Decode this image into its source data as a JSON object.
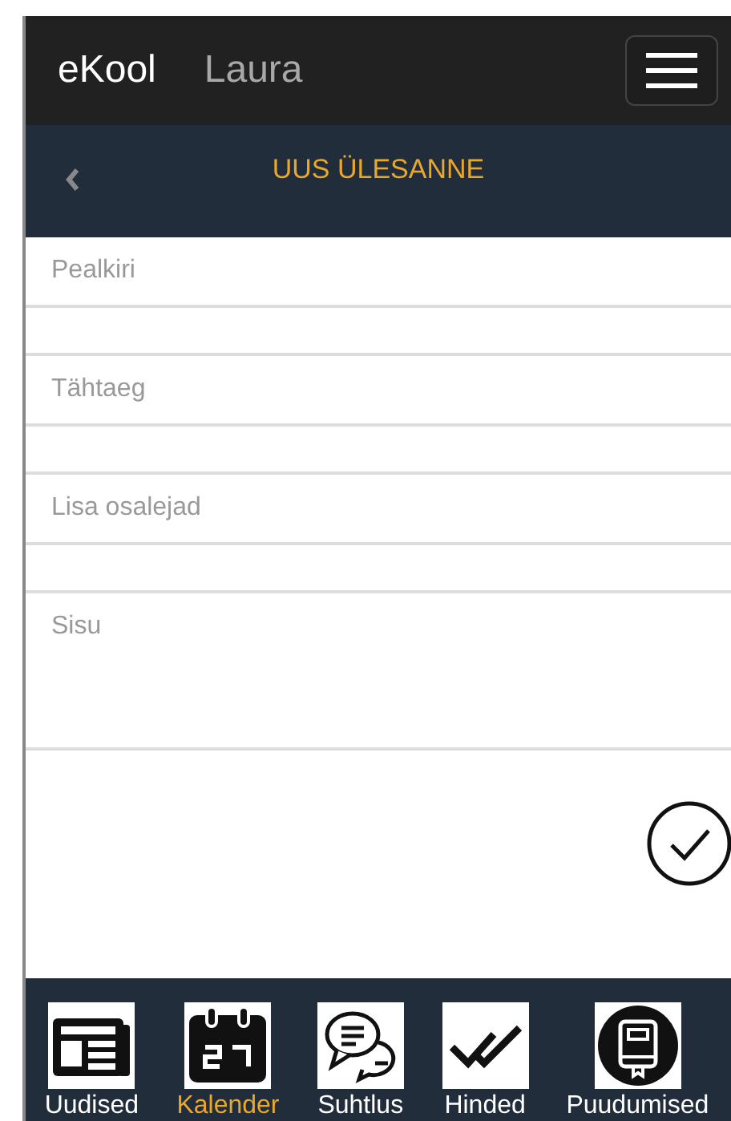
{
  "header": {
    "brand": "eKool",
    "user": "Laura"
  },
  "subheader": {
    "title": "UUS ÜLESANNE"
  },
  "fields": [
    {
      "kind": "line",
      "placeholder": "Pealkiri"
    },
    {
      "kind": "line",
      "placeholder": "Tähtaeg"
    },
    {
      "kind": "line",
      "placeholder": "Lisa osalejad"
    },
    {
      "kind": "area",
      "placeholder": "Sisu"
    }
  ],
  "tabs": [
    {
      "kind": "news",
      "label": "Uudised",
      "selected": false
    },
    {
      "kind": "calendar",
      "label": "Kalender",
      "selected": true
    },
    {
      "kind": "chat",
      "label": "Suhtlus",
      "selected": false
    },
    {
      "kind": "grades",
      "label": "Hinded",
      "selected": false
    },
    {
      "kind": "absence",
      "label": "Puudumised",
      "selected": false
    }
  ]
}
